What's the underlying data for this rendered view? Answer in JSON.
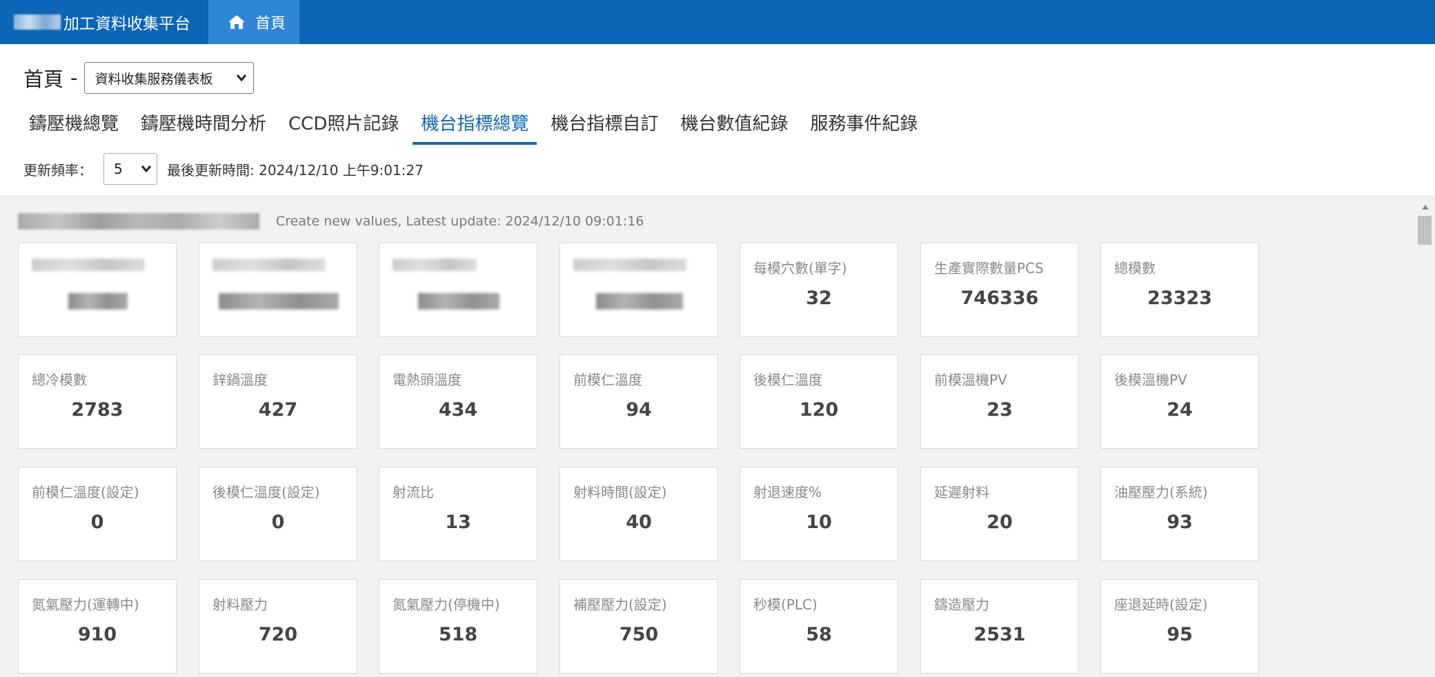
{
  "app": {
    "brand_title": "加工資料收集平台",
    "home_label": "首頁"
  },
  "page": {
    "title": "首頁",
    "dash": "-",
    "dashboard_select": "資料收集服務儀表板",
    "tabs": [
      {
        "label": "鑄壓機總覽",
        "active": false
      },
      {
        "label": "鑄壓機時間分析",
        "active": false
      },
      {
        "label": "CCD照片記錄",
        "active": false
      },
      {
        "label": "機台指標總覽",
        "active": true
      },
      {
        "label": "機台指標自訂",
        "active": false
      },
      {
        "label": "機台數值紀錄",
        "active": false
      },
      {
        "label": "服務事件紀錄",
        "active": false
      }
    ],
    "refresh_label": "更新頻率：",
    "refresh_interval": "5",
    "last_update": "最後更新時間: 2024/12/10 上午9:01:27"
  },
  "machine": {
    "meta": "Create new values, Latest update: 2024/12/10 09:01:16",
    "metrics": [
      {
        "label": "每模穴數(單字)",
        "value": "32"
      },
      {
        "label": "生產實際數量PCS",
        "value": "746336"
      },
      {
        "label": "總模數",
        "value": "23323"
      },
      {
        "label": "總冷模數",
        "value": "2783"
      },
      {
        "label": "鋅鍋溫度",
        "value": "427"
      },
      {
        "label": "電熱頭溫度",
        "value": "434"
      },
      {
        "label": "前模仁溫度",
        "value": "94"
      },
      {
        "label": "後模仁溫度",
        "value": "120"
      },
      {
        "label": "前模溫機PV",
        "value": "23"
      },
      {
        "label": "後模溫機PV",
        "value": "24"
      },
      {
        "label": "前模仁溫度(設定)",
        "value": "0"
      },
      {
        "label": "後模仁溫度(設定)",
        "value": "0"
      },
      {
        "label": "射流比",
        "value": "13"
      },
      {
        "label": "射料時間(設定)",
        "value": "40"
      },
      {
        "label": "射退速度%",
        "value": "10"
      },
      {
        "label": "延遲射料",
        "value": "20"
      },
      {
        "label": "油壓壓力(系統)",
        "value": "93"
      },
      {
        "label": "氮氣壓力(運轉中)",
        "value": "910"
      },
      {
        "label": "射料壓力",
        "value": "720"
      },
      {
        "label": "氮氣壓力(停機中)",
        "value": "518"
      },
      {
        "label": "補壓壓力(設定)",
        "value": "750"
      },
      {
        "label": "秒模(PLC)",
        "value": "58"
      },
      {
        "label": "鑄造壓力",
        "value": "2531"
      },
      {
        "label": "座退延時(設定)",
        "value": "95"
      }
    ]
  },
  "colors": {
    "primary": "#0b66b8",
    "home_tab": "#2f86d6",
    "background": "#f2f2f2"
  }
}
